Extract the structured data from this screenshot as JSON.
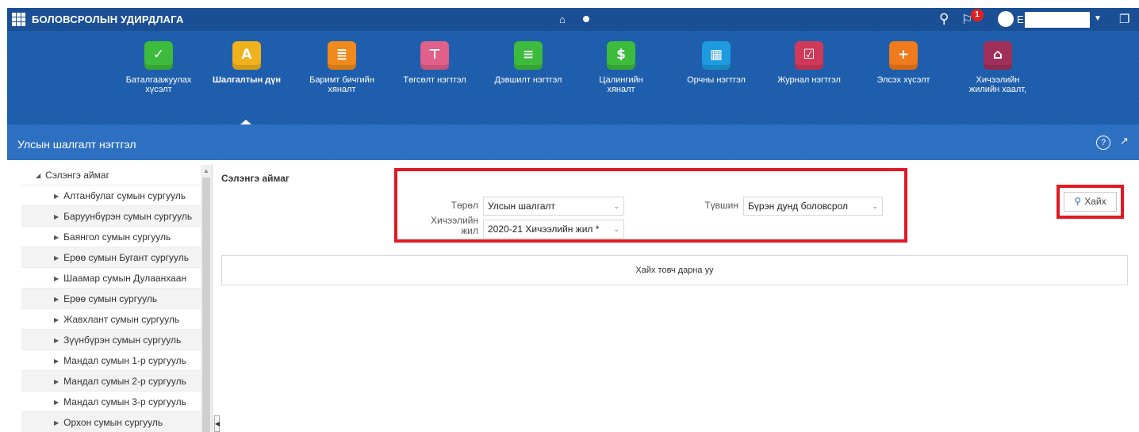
{
  "app": {
    "title": "БОЛОВСРОЛЫН УДИРДЛАГА",
    "user_initial": "E",
    "notification_count": "1"
  },
  "nav": {
    "items": [
      {
        "label_1": "Баталгаажуулах",
        "label_2": "хүсэлт",
        "color": "#3dbb3d",
        "glyph": "✓"
      },
      {
        "label_1": "Шалгалтын дүн",
        "label_2": "",
        "color": "#f0b21c",
        "glyph": "A"
      },
      {
        "label_1": "Баримт бичгийн",
        "label_2": "хяналт",
        "color": "#f08a1c",
        "glyph": "≣"
      },
      {
        "label_1": "Төгсөлт нэгтгэл",
        "label_2": "",
        "color": "#e0608a",
        "glyph": "⊤"
      },
      {
        "label_1": "Дэвшилт нэгтгэл",
        "label_2": "",
        "color": "#3dbb3d",
        "glyph": "≡"
      },
      {
        "label_1": "Цалингийн",
        "label_2": "хяналт",
        "color": "#3dbb3d",
        "glyph": "$"
      },
      {
        "label_1": "Орчны нэгтгэл",
        "label_2": "",
        "color": "#1e9be0",
        "glyph": "▦"
      },
      {
        "label_1": "Журнал нэгтгэл",
        "label_2": "",
        "color": "#d03a5a",
        "glyph": "☑"
      },
      {
        "label_1": "Элсэх хүсэлт",
        "label_2": "",
        "color": "#f07a1c",
        "glyph": "+"
      },
      {
        "label_1": "Хичээлийн",
        "label_2": "жилийн хаалт,",
        "color": "#a0305a",
        "glyph": "⌂"
      }
    ]
  },
  "section": {
    "title": "Улсын шалгалт нэгтгэл",
    "help": "?"
  },
  "tree": {
    "root": "Сэлэнгэ аймаг",
    "children": [
      "Алтанбулаг сумын сургууль",
      "Баруунбүрэн сумын сургууль",
      "Баянгол сумын сургууль",
      "Ерөө сумын Бугант сургууль",
      "Шаамар сумын Дулаанхаан",
      "Ерөө сумын сургууль",
      "Жавхлант сумын сургууль",
      "Зүүнбүрэн сумын сургууль",
      "Мандал сумын 1-р сургууль",
      "Мандал сумын 2-р сургууль",
      "Мандал сумын 3-р сургууль",
      "Орхон сумын сургууль"
    ]
  },
  "main": {
    "title": "Сэлэнгэ аймаг",
    "filters": {
      "type_label": "Төрөл",
      "type_value": "Улсын шалгалт",
      "level_label": "Түвшин",
      "level_value": "Бүрэн дунд боловсрол",
      "year_label_1": "Хичээлийн",
      "year_label_2": "жил",
      "year_value": "2020-21 Хичээлийн жил *"
    },
    "search_label": "Хайх",
    "result_message": "Хайх товч дарна уу"
  }
}
